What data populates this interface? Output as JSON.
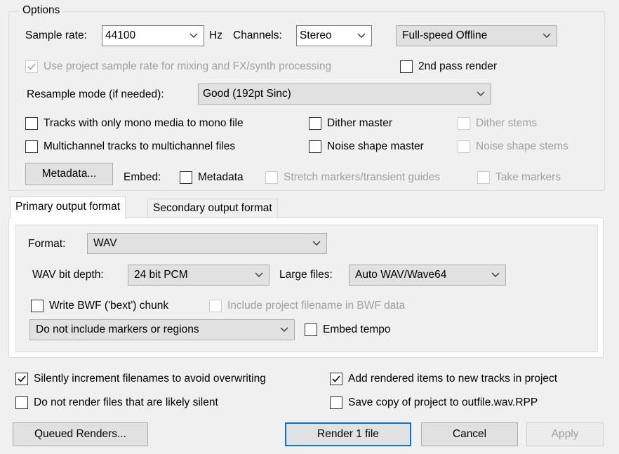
{
  "options": {
    "title": "Options",
    "sample_rate_label": "Sample rate:",
    "sample_rate_value": "44100",
    "hz_label": "Hz",
    "channels_label": "Channels:",
    "channels_value": "Stereo",
    "render_speed": "Full-speed Offline",
    "use_project_rate": "Use project sample rate for mixing and FX/synth processing",
    "second_pass": "2nd pass render",
    "resample_label": "Resample mode (if needed):",
    "resample_value": "Good (192pt Sinc)",
    "mono_tracks": "Tracks with only mono media to mono file",
    "dither_master": "Dither master",
    "dither_stems": "Dither stems",
    "multichannel": "Multichannel tracks to multichannel files",
    "noise_master": "Noise shape master",
    "noise_stems": "Noise shape stems",
    "metadata_button": "Metadata...",
    "embed_label": "Embed:",
    "embed_metadata": "Metadata",
    "embed_stretch": "Stretch markers/transient guides",
    "embed_take": "Take markers"
  },
  "tabs": {
    "primary": "Primary output format",
    "secondary": "Secondary output format"
  },
  "format": {
    "format_label": "Format:",
    "format_value": "WAV",
    "bit_depth_label": "WAV bit depth:",
    "bit_depth_value": "24 bit PCM",
    "large_files_label": "Large files:",
    "large_files_value": "Auto WAV/Wave64",
    "bwf_chunk": "Write BWF ('bext') chunk",
    "include_filename": "Include project filename in BWF data",
    "markers_value": "Do not include markers or regions",
    "embed_tempo": "Embed tempo"
  },
  "bottom": {
    "increment": "Silently increment filenames to avoid overwriting",
    "add_rendered": "Add rendered items to new tracks in project",
    "no_silent": "Do not render files that are likely silent",
    "save_copy": "Save copy of project to outfile.wav.RPP"
  },
  "buttons": {
    "queued": "Queued Renders...",
    "render": "Render 1 file",
    "cancel": "Cancel",
    "apply": "Apply"
  },
  "state": {
    "use_project_rate": true,
    "second_pass": false,
    "increment": true,
    "add_rendered": true,
    "no_silent": false,
    "save_copy": false
  }
}
